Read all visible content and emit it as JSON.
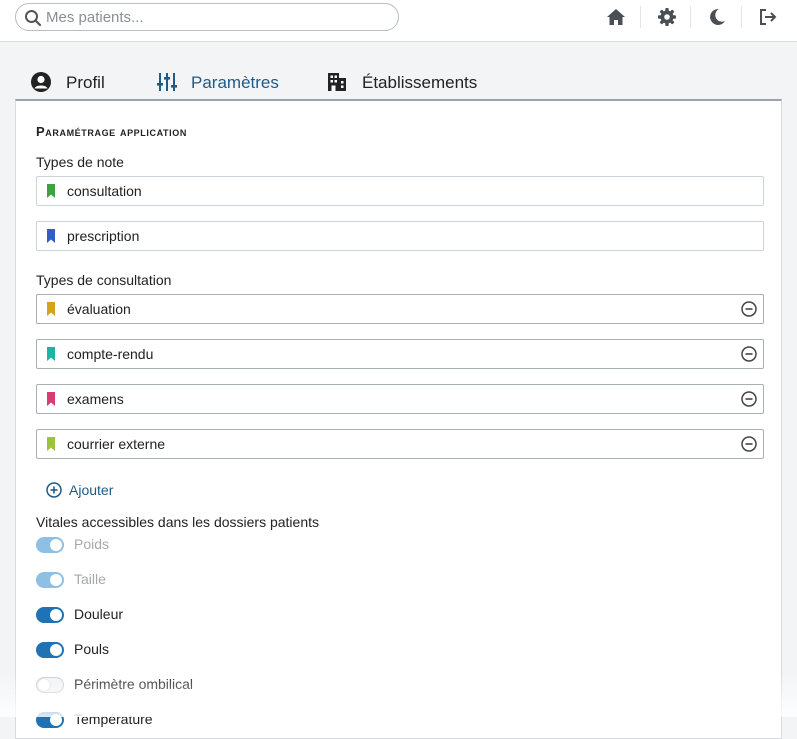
{
  "search": {
    "placeholder": "Mes patients..."
  },
  "toolbar": {
    "icons": [
      "home-icon",
      "gear-icon",
      "moon-icon",
      "logout-icon"
    ]
  },
  "tabs": [
    {
      "label": "Profil",
      "icon": "user-circle-icon",
      "active": false
    },
    {
      "label": "Paramètres",
      "icon": "sliders-icon",
      "active": true
    },
    {
      "label": "Établissements",
      "icon": "building-icon",
      "active": false
    }
  ],
  "settings": {
    "title": "Paramétrage application",
    "note_types_label": "Types de note",
    "note_types": [
      {
        "label": "consultation",
        "color": "#3aa53f"
      },
      {
        "label": "prescription",
        "color": "#2f5fc4"
      }
    ],
    "consultation_types_label": "Types de consultation",
    "consultation_types": [
      {
        "label": "évaluation",
        "color": "#d4a21c"
      },
      {
        "label": "compte-rendu",
        "color": "#1db3a6"
      },
      {
        "label": "examens",
        "color": "#d63d73"
      },
      {
        "label": "courrier externe",
        "color": "#9ac23a"
      }
    ],
    "add_label": "Ajouter",
    "vitals_label": "Vitales accessibles dans les dossiers patients",
    "vitals": [
      {
        "label": "Poids",
        "state": "disabled"
      },
      {
        "label": "Taille",
        "state": "disabled"
      },
      {
        "label": "Douleur",
        "state": "on"
      },
      {
        "label": "Pouls",
        "state": "on"
      },
      {
        "label": "Périmètre ombilical",
        "state": "off"
      },
      {
        "label": "Température",
        "state": "on"
      }
    ]
  },
  "colors": {
    "accent": "#1f6fa3",
    "toggle_on": "#1f73b5"
  }
}
